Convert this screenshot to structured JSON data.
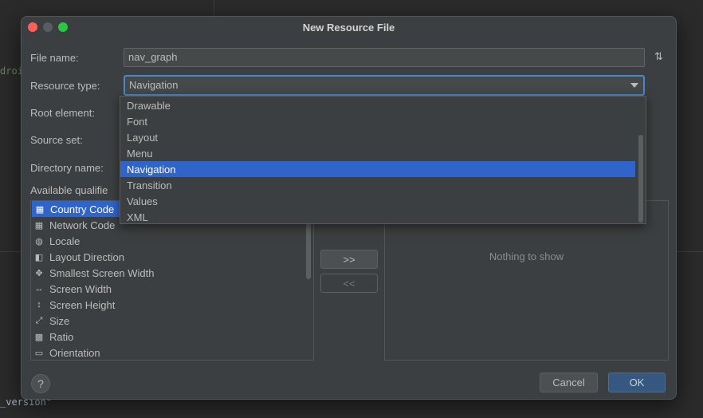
{
  "background": {
    "left_snippet": "droi",
    "bottom_snippet": "_version\""
  },
  "dialog": {
    "title": "New Resource File",
    "labels": {
      "file_name": "File name:",
      "resource_type": "Resource type:",
      "root_element": "Root element:",
      "source_set": "Source set:",
      "directory_name": "Directory name:",
      "available_qualifiers": "Available qualifie"
    },
    "file_name_value": "nav_graph",
    "sort_icon": "⇅",
    "resource_type_value": "Navigation",
    "resource_type_options": [
      "Drawable",
      "Font",
      "Layout",
      "Menu",
      "Navigation",
      "Transition",
      "Values",
      "XML"
    ],
    "selected_option_index": 4,
    "qualifiers": [
      {
        "label": "Country Code",
        "icon": "country-code-icon",
        "glyph": "▦"
      },
      {
        "label": "Network Code",
        "icon": "network-code-icon",
        "glyph": "▦"
      },
      {
        "label": "Locale",
        "icon": "globe-icon",
        "glyph": "◍"
      },
      {
        "label": "Layout Direction",
        "icon": "layout-direction-icon",
        "glyph": "◧"
      },
      {
        "label": "Smallest Screen Width",
        "icon": "smallest-width-icon",
        "glyph": "✥"
      },
      {
        "label": "Screen Width",
        "icon": "screen-width-icon",
        "glyph": "↔"
      },
      {
        "label": "Screen Height",
        "icon": "screen-height-icon",
        "glyph": "↕"
      },
      {
        "label": "Size",
        "icon": "size-icon",
        "glyph": "⤢"
      },
      {
        "label": "Ratio",
        "icon": "ratio-icon",
        "glyph": "▩"
      },
      {
        "label": "Orientation",
        "icon": "orientation-icon",
        "glyph": "▭"
      }
    ],
    "add_button": ">>",
    "remove_button": "<<",
    "chosen_empty_text": "Nothing to show",
    "help_button": "?",
    "cancel_button": "Cancel",
    "ok_button": "OK"
  }
}
